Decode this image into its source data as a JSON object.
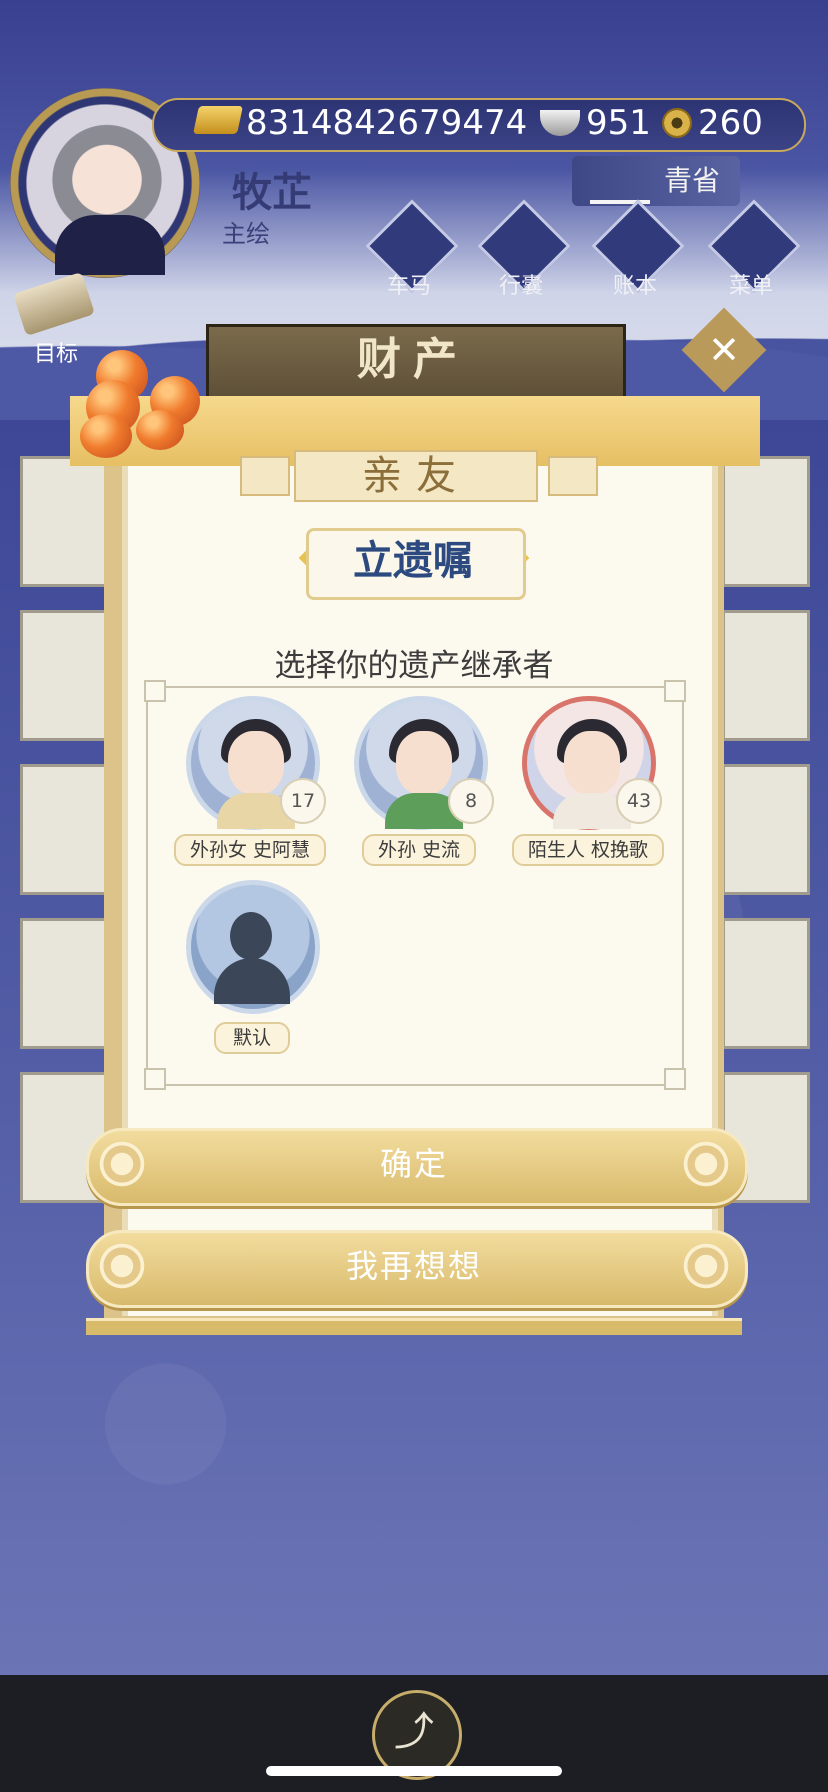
{
  "player": {
    "name": "牧芷",
    "title": "主绘"
  },
  "resources": {
    "gold": "8314842679474",
    "silver": "951",
    "coin": "260"
  },
  "qingxing": {
    "label": "青省"
  },
  "nav": [
    {
      "label": "车马",
      "icon": "carriage-icon"
    },
    {
      "label": "行囊",
      "icon": "bag-icon"
    },
    {
      "label": "账本",
      "icon": "ledger-icon"
    },
    {
      "label": "菜单",
      "icon": "menu-icon"
    }
  ],
  "goal": {
    "label": "目标"
  },
  "banner": {
    "title": "财产"
  },
  "panel": {
    "tab": "亲友",
    "title": "立遗嘱",
    "subtitle": "选择你的遗产继承者",
    "heirs": [
      {
        "name": "外孙女 史阿慧",
        "age": "17"
      },
      {
        "name": "外孙 史流",
        "age": "8"
      },
      {
        "name": "陌生人 权挽歌",
        "age": "43"
      }
    ],
    "default_label": "默认",
    "confirm_label": "确定",
    "reconsider_label": "我再想想"
  },
  "colors": {
    "accent_gold": "#d8ba6b",
    "title_blue": "#2c4a7f",
    "background_indigo": "#3b4595"
  }
}
